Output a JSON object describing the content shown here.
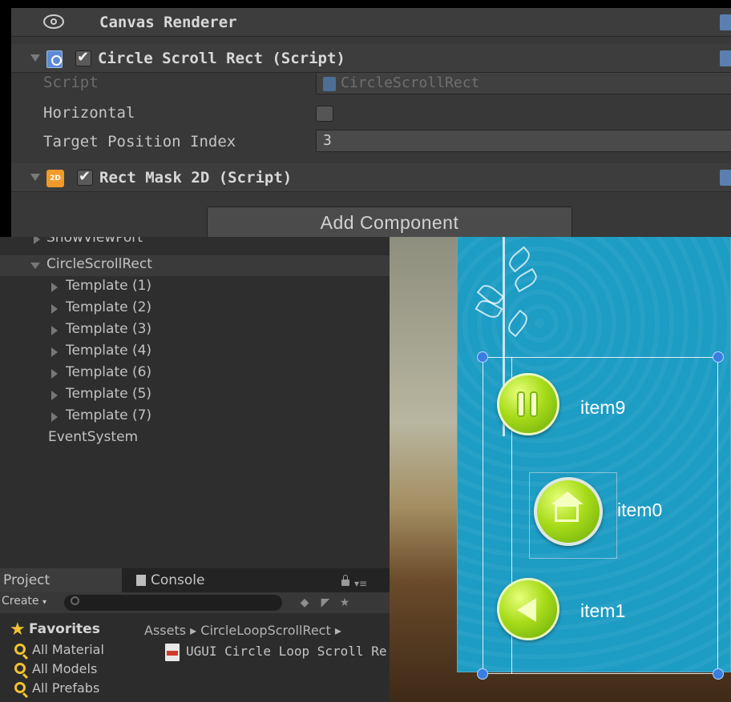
{
  "inspector": {
    "canvas_renderer": {
      "title": "Canvas Renderer"
    },
    "circle_scroll_rect": {
      "title": "Circle Scroll Rect (Script)",
      "enabled": true,
      "script_label": "Script",
      "script_value": "CircleScrollRect",
      "horizontal_label": "Horizontal",
      "horizontal_value": false,
      "target_index_label": "Target Position Index",
      "target_index_value": "3"
    },
    "rect_mask": {
      "title": "Rect Mask 2D (Script)",
      "enabled": true,
      "icon_text": "2D"
    },
    "add_component_label": "Add Component"
  },
  "hierarchy": {
    "items": [
      {
        "label": "ShowViewPort"
      },
      {
        "label": "CircleScrollRect"
      },
      {
        "label": "Template (1)"
      },
      {
        "label": "Template (2)"
      },
      {
        "label": "Template (3)"
      },
      {
        "label": "Template (4)"
      },
      {
        "label": "Template (6)"
      },
      {
        "label": "Template (5)"
      },
      {
        "label": "Template (7)"
      },
      {
        "label": "EventSystem"
      }
    ]
  },
  "project": {
    "tabs": {
      "project": "Project",
      "console": "Console"
    },
    "create_label": "Create",
    "favorites": {
      "title": "Favorites",
      "items": [
        "All Material",
        "All Models",
        "All Prefabs"
      ]
    },
    "breadcrumb": "Assets ▸ CircleLoopScrollRect ▸",
    "asset": "UGUI Circle Loop Scroll Re"
  },
  "scene": {
    "items": [
      "item9",
      "item0",
      "item1"
    ],
    "accent_blue": "#1d9cc4",
    "button_green": "#a8dc1a"
  }
}
